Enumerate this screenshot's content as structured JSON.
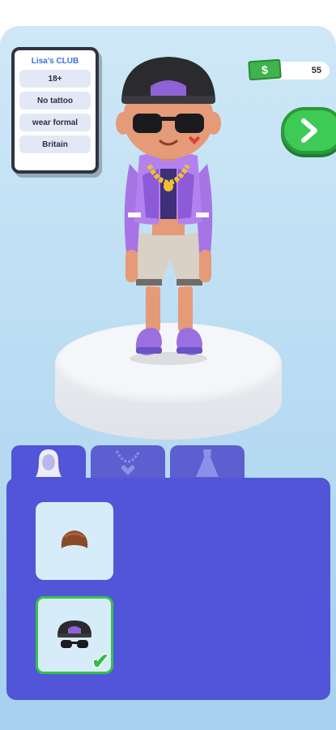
{
  "rules_card": {
    "title": "Lisa's CLUB",
    "rules": [
      "18+",
      "No tattoo",
      "wear formal",
      "Britain"
    ]
  },
  "currency": {
    "icon": "dollar-bill-icon",
    "symbol": "$",
    "amount": "55"
  },
  "next_button": {
    "icon": "chevron-right-icon"
  },
  "character": {
    "description_icon": "avatar-character"
  },
  "shop": {
    "tabs": [
      {
        "icon": "hair-icon",
        "active": true
      },
      {
        "icon": "necklace-icon",
        "active": false
      },
      {
        "icon": "dress-icon",
        "active": false
      }
    ],
    "items": [
      {
        "icon": "brown-hair-icon",
        "selected": false
      },
      {
        "icon": "black-cap-sunglasses-icon",
        "selected": true,
        "check": "✔"
      }
    ]
  },
  "colors": {
    "accent": "#5155d8",
    "next": "#3ecb55",
    "background": "#b7dbf2"
  }
}
